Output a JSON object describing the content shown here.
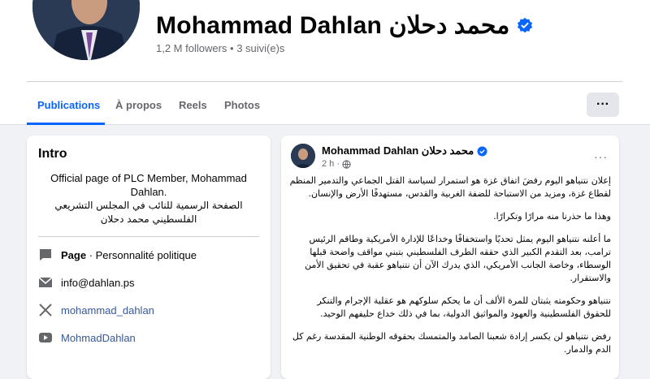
{
  "profile": {
    "name": "Mohammad Dahlan محمد دحلان",
    "followers": "1,2 M followers • 3 suivi(e)s"
  },
  "tabs": [
    {
      "label": "Publications",
      "active": true
    },
    {
      "label": "À propos",
      "active": false
    },
    {
      "label": "Reels",
      "active": false
    },
    {
      "label": "Photos",
      "active": false
    }
  ],
  "more_button": "···",
  "intro": {
    "title": "Intro",
    "bio_en": "Official page of PLC Member, Mohammad Dahlan.",
    "bio_ar": "الصفحة الرسمية للنائب في المجلس التشريعي الفلسطيني محمد دحلان",
    "page_label": "Page",
    "page_category": " · Personnalité politique",
    "email": "info@dahlan.ps",
    "twitter": "mohammad_dahlan",
    "youtube": "MohmadDahlan"
  },
  "post": {
    "author": "Mohammad Dahlan محمد دحلان",
    "time": "2 h ·",
    "more": "···",
    "paragraphs": [
      "إعلان نتنياهو اليوم رفضَ اتفاق غزة هو استمرار لسياسة القتل الجماعي والتدمير المنظم لقطاع غزة، ومزيد من الاستباحة للضفة الغربية والقدس، مستهدفًا الأرض والإنسان.",
      "وهذا ما حذرنا منه مرارًا وتكرارًا.",
      "ما أعلنه نتنياهو اليوم يمثل تحديًا واستخفافًا وخداعًا للإدارة الأمريكية وطاقم الرئيس ترامب، بعد التقدم الكبير الذي حققه الطرف الفلسطيني بتبني مواقف واضحة قبلها الوسطاء، وخاصة الجانب الأمريكي، الذي يدرك الآن أن نتنياهو عقبة في تحقيق الأمن والاستقرار.",
      "نتنياهو وحكومته يثبتان للمرة الألف أن ما يحكم سلوكهم هو عقلية الإجرام والتنكر للحقوق الفلسطينية والعهود والمواثيق الدولية، بما في ذلك خداع حليفهم الوحيد.",
      "رفض نتنياهو لن يكسر إرادة شعبنا الصامد والمتمسك بحقوقه الوطنية المقدسة رغم كل الدم والدمار."
    ]
  },
  "colors": {
    "accent": "#0866ff",
    "verified": "#0866ff",
    "muted_text": "#65676b",
    "background": "#f0f2f5"
  }
}
